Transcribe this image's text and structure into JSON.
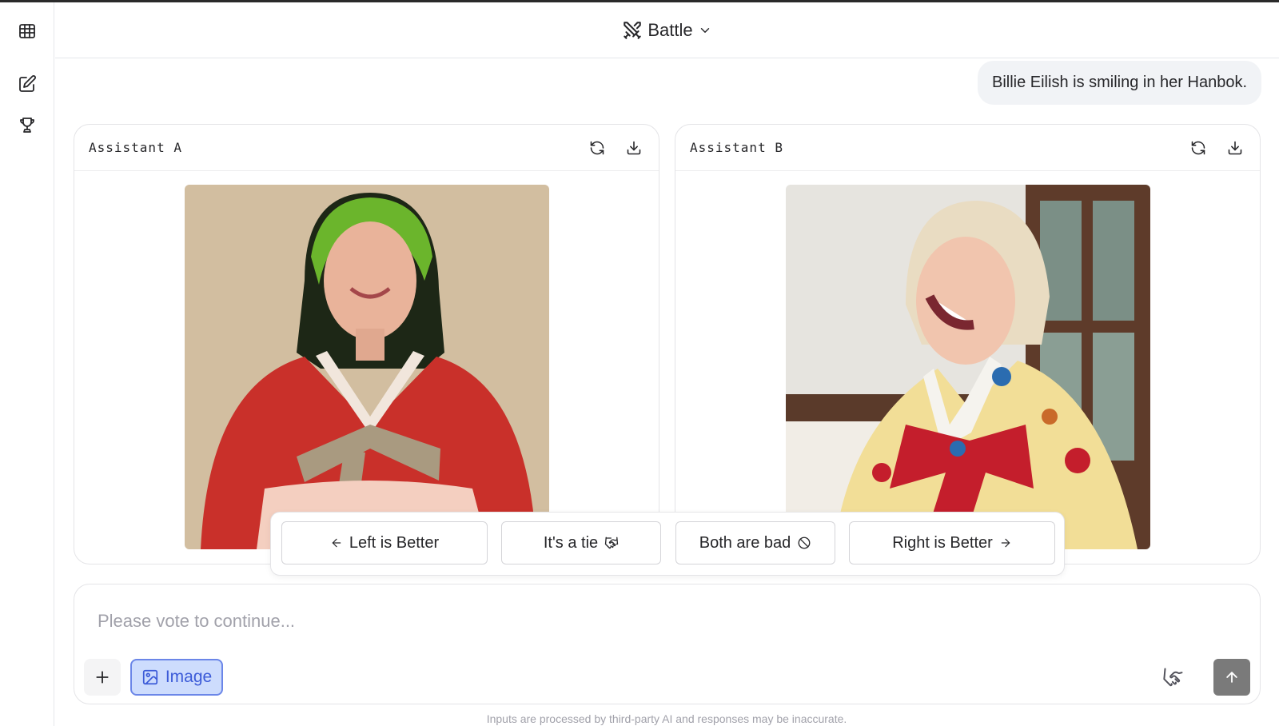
{
  "header": {
    "mode_label": "Battle"
  },
  "sidebar": {
    "items": [
      {
        "icon": "leaderboard-table-icon"
      },
      {
        "icon": "new-chat-icon"
      },
      {
        "icon": "trophy-icon"
      }
    ]
  },
  "chat": {
    "user_prompt": "Billie Eilish is smiling in her Hanbok."
  },
  "panels": [
    {
      "title": "Assistant A",
      "tools": [
        "regenerate-icon",
        "download-icon"
      ]
    },
    {
      "title": "Assistant B",
      "tools": [
        "regenerate-icon",
        "download-icon"
      ]
    }
  ],
  "vote": {
    "left_label": "Left is Better",
    "tie_label": "It's a tie",
    "bad_label": "Both are bad",
    "right_label": "Right is Better"
  },
  "composer": {
    "placeholder": "Please vote to continue...",
    "image_toggle_label": "Image"
  },
  "footer": {
    "disclaimer": "Inputs are processed by third-party AI and responses may be inaccurate."
  },
  "colors": {
    "accent": "#3c5bd8",
    "accent_bg": "#cddcfd",
    "send_bg": "#7a7a7a"
  }
}
